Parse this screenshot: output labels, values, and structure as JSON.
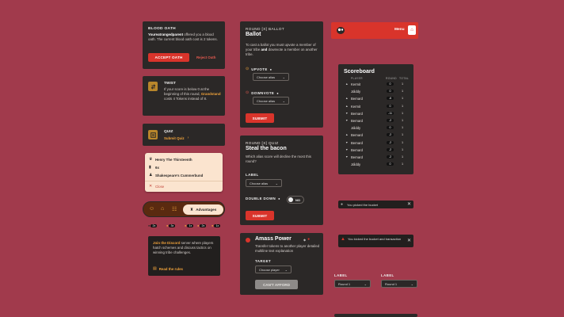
{
  "blood_oath": {
    "title": "BLOOD OATH",
    "text_name": "Youreatrangedparent",
    "text_rest": " offered you a blood oath. The current blood oath cost is 2 tokens.",
    "accept": "ACCEPT OATH",
    "reject": "Reject Oath"
  },
  "twist": {
    "title": "TWIST",
    "text_a": "If your score is below 0 at the beginning of this round, ",
    "text_name": "Grandstand",
    "text_b": " costs 4 Tokens instead of 8."
  },
  "quiz_card": {
    "title": "QUIZ",
    "link": "Submit Quiz"
  },
  "advantage_menu": {
    "items": [
      "Henry The Thirsteenth",
      "6x",
      "Shakespeare's Cummerbund"
    ],
    "close": "Close"
  },
  "tabbar": {
    "active_label": "Advantages"
  },
  "mini_badges": [
    "2x",
    "3x",
    "1x",
    "2x",
    "1x"
  ],
  "join_discord": {
    "link": "Join the Discord",
    "text": " server where players hatch schemes and discuss tactics on winning tribe challenges.",
    "rules": "Read the rules"
  },
  "ballot": {
    "overline": "ROUND [X] BALLOT",
    "title": "Ballot",
    "desc_a": "To cast a ballot you must upvote a member of your tribe ",
    "desc_and": "and",
    "desc_b": " downvote a member on another tribe.",
    "upvote": "UPVOTE",
    "downvote": "DOWNVOTE",
    "select_placeholder": "Choose alias",
    "submit": "SUBMIT"
  },
  "quiz": {
    "overline": "ROUND [X] QUIZ",
    "title": "Steal the bacon",
    "desc": "Which alias score will decline the most this round?",
    "label": "LABEL",
    "select_placeholder": "Choose alias",
    "double_down": "DOUBLE DOWN",
    "toggle": "NO",
    "submit": "SUBMIT"
  },
  "amass": {
    "title": "Amass Power",
    "desc": "Transfer tokens to another player detailed multiline text explanation",
    "target": "TARGET",
    "select_placeholder": "Choose player",
    "cant": "CAN'T AFFORD"
  },
  "header_bar": {
    "menu": "Menu"
  },
  "scoreboard": {
    "title": "Scoreboard",
    "cols": [
      "PLAYER",
      "ROUND",
      "TOTAL"
    ],
    "rows": [
      {
        "arrow": "up",
        "name": "Kermit",
        "round": "0",
        "total": "1"
      },
      {
        "arrow": "",
        "name": "Jdiddy",
        "round": "0",
        "total": "1"
      },
      {
        "arrow": "up",
        "name": "Bernard",
        "round": "-6",
        "total": "1"
      },
      {
        "arrow": "up",
        "name": "Kermit",
        "round": "0",
        "total": "1"
      },
      {
        "arrow": "down",
        "name": "Bernard",
        "round": "-11",
        "total": "1"
      },
      {
        "arrow": "down",
        "name": "Bernard",
        "round": "-2",
        "total": "1"
      },
      {
        "arrow": "",
        "name": "Jdiddy",
        "round": "0",
        "total": "1"
      },
      {
        "arrow": "up",
        "name": "Bernard",
        "round": "-2",
        "total": "1"
      },
      {
        "arrow": "down",
        "name": "Bernard",
        "round": "-2",
        "total": "1"
      },
      {
        "arrow": "down",
        "name": "Bernard",
        "round": "-2",
        "total": "1"
      },
      {
        "arrow": "down",
        "name": "Bernard",
        "round": "-2",
        "total": "1"
      },
      {
        "arrow": "",
        "name": "Jdiddy",
        "round": "0",
        "total": "1"
      }
    ]
  },
  "toast1": {
    "text": "You picked the bucket"
  },
  "toast2": {
    "text": "You kicked the bucket and transaction"
  },
  "selects": [
    {
      "label": "LABEL",
      "value": "Round 1"
    },
    {
      "label": "LABEL",
      "value": "Round 1"
    }
  ],
  "colors": {
    "bg": "#a13a4c",
    "card": "#2b2827",
    "red": "#d9342b",
    "gold": "#b8862b"
  }
}
